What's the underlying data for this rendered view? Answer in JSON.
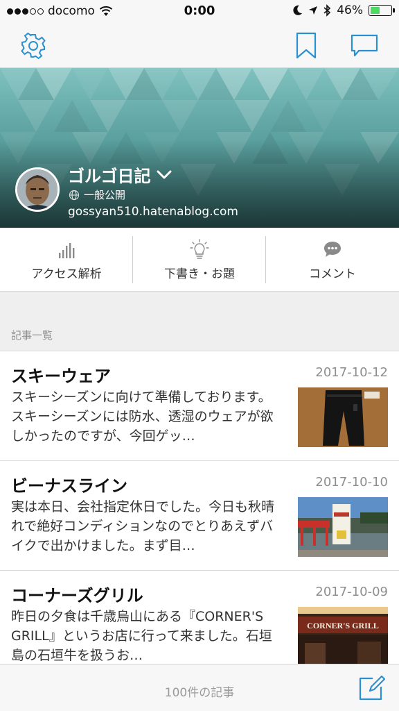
{
  "status_bar": {
    "carrier": "docomo",
    "time": "0:00",
    "battery": "46%",
    "battery_level": 0.46
  },
  "nav": {
    "left_icon": "gear-icon",
    "right_icons": [
      "bookmark-icon",
      "chat-bubble-icon"
    ]
  },
  "blog": {
    "title": "ゴルゴ日記",
    "visibility": "一般公開",
    "url": "gossyan510.hatenablog.com"
  },
  "actions": [
    {
      "label": "アクセス解析",
      "icon": "bar-chart-icon"
    },
    {
      "label": "下書き・お題",
      "icon": "lightbulb-icon"
    },
    {
      "label": "コメント",
      "icon": "comment-bubble-icon"
    }
  ],
  "section": {
    "title": "記事一覧"
  },
  "articles": [
    {
      "title": "スキーウェア",
      "date": "2017-10-12",
      "excerpt": "スキーシーズンに向けて準備しております。スキーシーズンには防水、透湿のウェアが欲しかったのですが、今回ゲッ…"
    },
    {
      "title": "ビーナスライン",
      "date": "2017-10-10",
      "excerpt": "実は本日、会社指定休日でした。今日も秋晴れで絶好コンディションなのでとりあえずバイクで出かけました。まず目…"
    },
    {
      "title": "コーナーズグリル",
      "date": "2017-10-09",
      "excerpt": "昨日の夕食は千歳烏山にある『CORNER'S GRILL』というお店に行って来ました。石垣島の石垣牛を扱うお…",
      "thumb_sign": "CORNER'S GRILL"
    }
  ],
  "footer": {
    "count_label": "100件の記事",
    "compose_icon": "compose-icon"
  },
  "colors": {
    "accent": "#2a90d0",
    "banner": "#5fa9a7"
  }
}
